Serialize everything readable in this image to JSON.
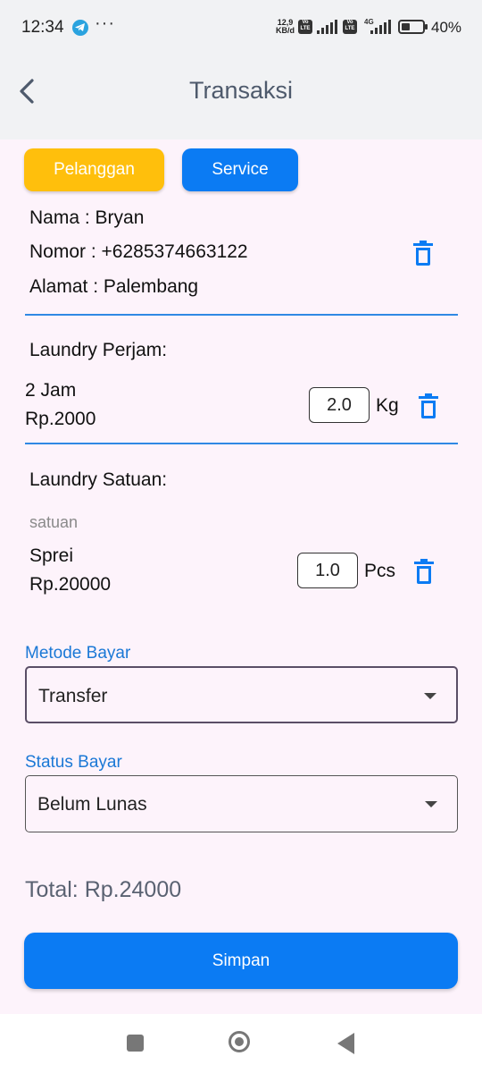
{
  "status_bar": {
    "time": "12:34",
    "more": "···",
    "net_speed_value": "12,9",
    "net_speed_unit": "KB/d",
    "volte1": "Vo LTE",
    "volte2": "Vo LTE",
    "network": "4G",
    "battery_level": 0.4,
    "battery_text": "40%"
  },
  "app_bar": {
    "title": "Transaksi",
    "back_icon": "chevron-left-icon"
  },
  "tabs": [
    {
      "label": "Pelanggan",
      "color": "#ffbf0c"
    },
    {
      "label": "Service",
      "color": "#0b7bf3"
    }
  ],
  "customer": {
    "nama": "Nama : Bryan",
    "nomor": "Nomor : +6285374663122",
    "alamat": "Alamat : Palembang",
    "delete_icon": "trash-icon"
  },
  "laundry_perjam": {
    "heading": "Laundry Perjam:",
    "items": [
      {
        "name": "2 Jam",
        "price": "Rp.2000",
        "qty": "2.0",
        "unit": "Kg"
      }
    ]
  },
  "laundry_satuan": {
    "heading": "Laundry Satuan:",
    "subheading": "satuan",
    "items": [
      {
        "name": "Sprei",
        "price": "Rp.20000",
        "qty": "1.0",
        "unit": "Pcs"
      }
    ]
  },
  "metode_bayar": {
    "label": "Metode Bayar",
    "value": "Transfer"
  },
  "status_bayar": {
    "label": "Status Bayar",
    "value": "Belum Lunas"
  },
  "total": "Total: Rp.24000",
  "save_label": "Simpan",
  "colors": {
    "primary": "#0b7bf3",
    "accent": "#ffbf0c",
    "label_blue": "#1b78d6",
    "background": "#fdf3fb"
  }
}
